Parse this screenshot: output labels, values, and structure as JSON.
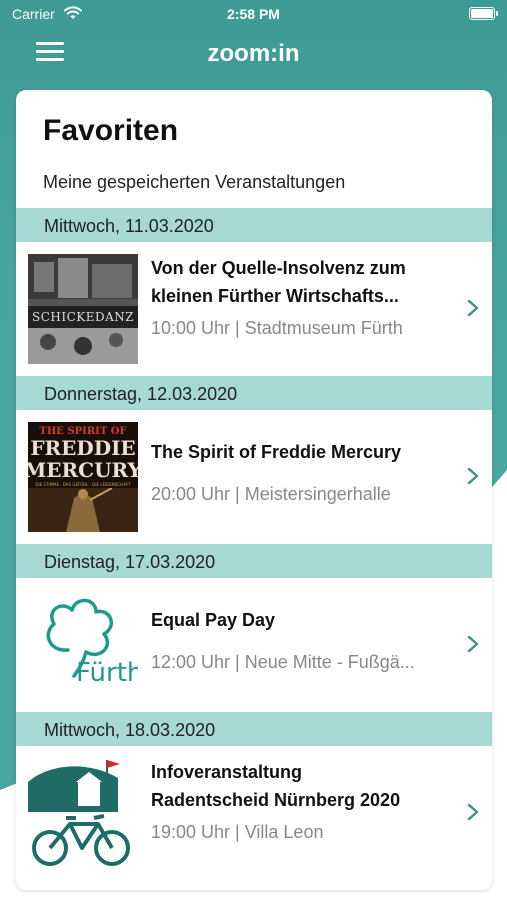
{
  "status_bar": {
    "carrier": "Carrier",
    "time": "2:58 PM"
  },
  "nav": {
    "title": "zoom:in"
  },
  "page": {
    "title": "Favoriten",
    "subtitle": "Meine gespeicherten Veranstaltungen"
  },
  "sections": [
    {
      "date": "Mittwoch, 11.03.2020",
      "event": {
        "title_line1": "Von der Quelle-Insolvenz zum",
        "title_line2": "kleinen Fürther Wirtschafts...",
        "meta": "10:00 Uhr | Stadtmuseum Fürth",
        "thumb_text": "SCHICKEDANZ"
      }
    },
    {
      "date": "Donnerstag, 12.03.2020",
      "event": {
        "title_line1": "The Spirit of Freddie Mercury",
        "meta": "20:00 Uhr | Meistersingerhalle",
        "thumb_line1": "THE SPIRIT OF",
        "thumb_line2": "FREDDIE",
        "thumb_line3": "MERCURY",
        "thumb_line4": "DIE STIMME · DAS GEFÜHL · DIE LEIDENSCHAFT"
      }
    },
    {
      "date": "Dienstag, 17.03.2020",
      "event": {
        "title_line1": "Equal Pay Day",
        "meta": "12:00 Uhr | Neue Mitte - Fußgä...",
        "thumb_text": "Fürth"
      }
    },
    {
      "date": "Mittwoch, 18.03.2020",
      "event": {
        "title_line1": "Infoveranstaltung",
        "title_line2": "Radentscheid Nürnberg 2020",
        "meta": "19:00 Uhr | Villa Leon"
      }
    }
  ],
  "colors": {
    "brand": "#4aa6a1",
    "section_bg": "#a6d8d4",
    "chevron": "#3f8f8f"
  },
  "icons": [
    "wifi-icon",
    "battery-icon",
    "menu-icon",
    "chevron-right-icon"
  ]
}
